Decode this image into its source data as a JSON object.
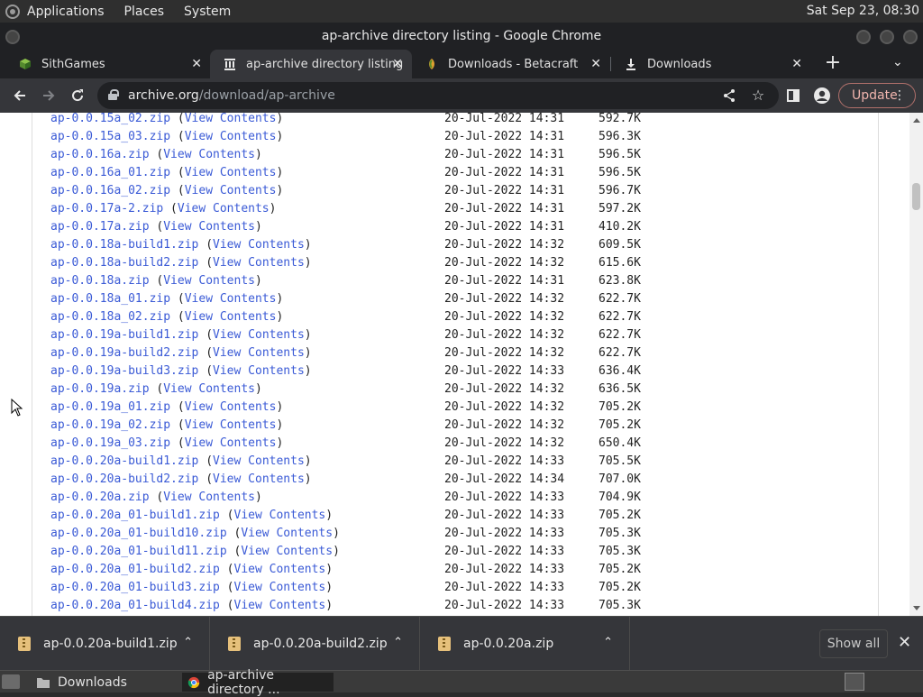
{
  "desktop": {
    "menus": [
      "Applications",
      "Places",
      "System"
    ],
    "clock": "Sat Sep 23, 08:30"
  },
  "window": {
    "title": "ap-archive directory listing - Google Chrome"
  },
  "tabs": [
    {
      "label": "SithGames",
      "icon": "cube-icon"
    },
    {
      "label": "ap-archive directory listing",
      "icon": "archive-icon"
    },
    {
      "label": "Downloads - Betacraft",
      "icon": "betacraft-icon"
    },
    {
      "label": "Downloads",
      "icon": "download-icon"
    }
  ],
  "toolbar": {
    "url_host": "archive.org",
    "url_path": "/download/ap-archive",
    "update_label": "Update"
  },
  "listing": {
    "view_label": "View Contents",
    "rows": [
      {
        "file": "ap-0.0.15a_02.zip",
        "date": "20-Jul-2022 14:31",
        "size": "592.7K"
      },
      {
        "file": "ap-0.0.15a_03.zip",
        "date": "20-Jul-2022 14:31",
        "size": "596.3K"
      },
      {
        "file": "ap-0.0.16a.zip",
        "date": "20-Jul-2022 14:31",
        "size": "596.5K"
      },
      {
        "file": "ap-0.0.16a_01.zip",
        "date": "20-Jul-2022 14:31",
        "size": "596.5K"
      },
      {
        "file": "ap-0.0.16a_02.zip",
        "date": "20-Jul-2022 14:31",
        "size": "596.7K"
      },
      {
        "file": "ap-0.0.17a-2.zip",
        "date": "20-Jul-2022 14:31",
        "size": "597.2K"
      },
      {
        "file": "ap-0.0.17a.zip",
        "date": "20-Jul-2022 14:31",
        "size": "410.2K"
      },
      {
        "file": "ap-0.0.18a-build1.zip",
        "date": "20-Jul-2022 14:32",
        "size": "609.5K"
      },
      {
        "file": "ap-0.0.18a-build2.zip",
        "date": "20-Jul-2022 14:32",
        "size": "615.6K"
      },
      {
        "file": "ap-0.0.18a.zip",
        "date": "20-Jul-2022 14:31",
        "size": "623.8K"
      },
      {
        "file": "ap-0.0.18a_01.zip",
        "date": "20-Jul-2022 14:32",
        "size": "622.7K"
      },
      {
        "file": "ap-0.0.18a_02.zip",
        "date": "20-Jul-2022 14:32",
        "size": "622.7K"
      },
      {
        "file": "ap-0.0.19a-build1.zip",
        "date": "20-Jul-2022 14:32",
        "size": "622.7K"
      },
      {
        "file": "ap-0.0.19a-build2.zip",
        "date": "20-Jul-2022 14:32",
        "size": "622.7K"
      },
      {
        "file": "ap-0.0.19a-build3.zip",
        "date": "20-Jul-2022 14:33",
        "size": "636.4K"
      },
      {
        "file": "ap-0.0.19a.zip",
        "date": "20-Jul-2022 14:32",
        "size": "636.5K"
      },
      {
        "file": "ap-0.0.19a_01.zip",
        "date": "20-Jul-2022 14:32",
        "size": "705.2K"
      },
      {
        "file": "ap-0.0.19a_02.zip",
        "date": "20-Jul-2022 14:32",
        "size": "705.2K"
      },
      {
        "file": "ap-0.0.19a_03.zip",
        "date": "20-Jul-2022 14:32",
        "size": "650.4K"
      },
      {
        "file": "ap-0.0.20a-build1.zip",
        "date": "20-Jul-2022 14:33",
        "size": "705.5K"
      },
      {
        "file": "ap-0.0.20a-build2.zip",
        "date": "20-Jul-2022 14:34",
        "size": "707.0K"
      },
      {
        "file": "ap-0.0.20a.zip",
        "date": "20-Jul-2022 14:33",
        "size": "704.9K"
      },
      {
        "file": "ap-0.0.20a_01-build1.zip",
        "date": "20-Jul-2022 14:33",
        "size": "705.2K"
      },
      {
        "file": "ap-0.0.20a_01-build10.zip",
        "date": "20-Jul-2022 14:33",
        "size": "705.3K"
      },
      {
        "file": "ap-0.0.20a_01-build11.zip",
        "date": "20-Jul-2022 14:33",
        "size": "705.3K"
      },
      {
        "file": "ap-0.0.20a_01-build2.zip",
        "date": "20-Jul-2022 14:33",
        "size": "705.2K"
      },
      {
        "file": "ap-0.0.20a_01-build3.zip",
        "date": "20-Jul-2022 14:33",
        "size": "705.2K"
      },
      {
        "file": "ap-0.0.20a_01-build4.zip",
        "date": "20-Jul-2022 14:33",
        "size": "705.3K"
      }
    ]
  },
  "downloads": {
    "items": [
      {
        "name": "ap-0.0.20a-build1.zip"
      },
      {
        "name": "ap-0.0.20a-build2.zip"
      },
      {
        "name": "ap-0.0.20a.zip"
      }
    ],
    "show_all_label": "Show all"
  },
  "taskbar": {
    "tasks": [
      {
        "label": "Downloads"
      },
      {
        "label": "ap-archive directory ..."
      }
    ]
  },
  "colors": {
    "link": "#3a5ad6",
    "chrome_dark": "#202124",
    "chrome_toolbar": "#35363a",
    "update_accent": "#f0b5ae"
  }
}
